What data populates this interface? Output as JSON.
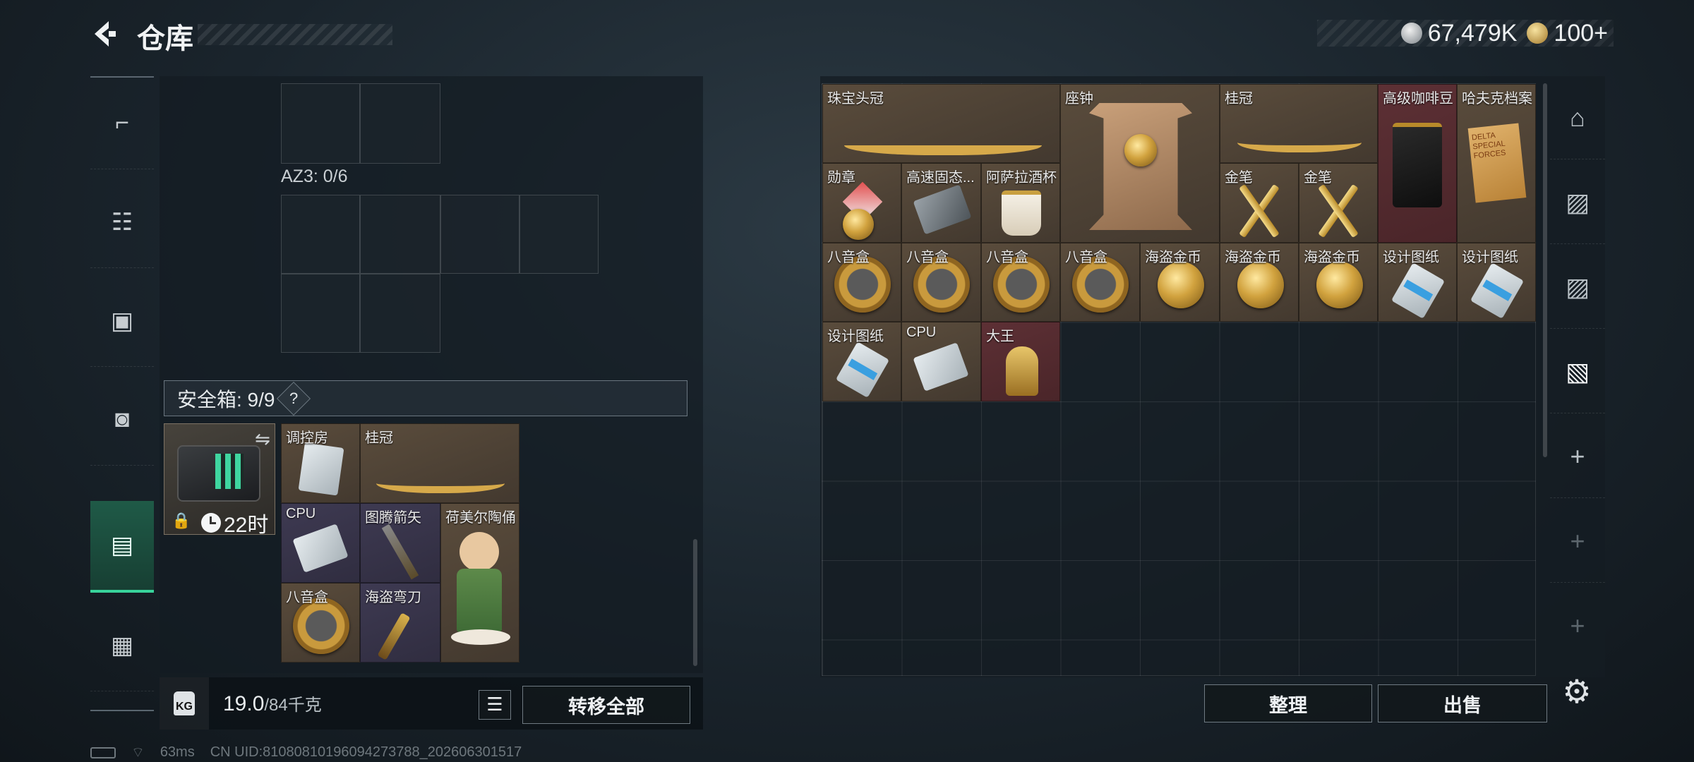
{
  "header": {
    "title": "仓库"
  },
  "currency": [
    {
      "icon": "silver-coin-icon",
      "value": "67,479K"
    },
    {
      "icon": "gold-coin-icon",
      "value": "100+"
    }
  ],
  "side_nav": [
    {
      "icon": "gun-icon",
      "glyph": "⌐"
    },
    {
      "icon": "vest-icon",
      "glyph": "☷"
    },
    {
      "icon": "chest-rig-icon",
      "glyph": "▣"
    },
    {
      "icon": "backpack-icon",
      "glyph": "◙"
    },
    {
      "icon": "safe-box-icon",
      "glyph": "▤",
      "active": true
    },
    {
      "icon": "toolbox-icon",
      "glyph": "▦"
    }
  ],
  "left_storage": {
    "container_label": "AZ3: 0/6",
    "safebox_label": "安全箱: 9/9",
    "help": "?",
    "case_timer": "22时",
    "items": [
      {
        "name": "调控房"
      },
      {
        "name": "桂冠"
      },
      {
        "name": "CPU"
      },
      {
        "name": "图腾箭矢"
      },
      {
        "name": "荷美尔陶俑"
      },
      {
        "name": "八音盒"
      },
      {
        "name": "海盗弯刀"
      }
    ]
  },
  "weight": {
    "current": "19.0",
    "max": "/84千克",
    "icon_text": "KG"
  },
  "left_buttons": {
    "transfer_all": "转移全部"
  },
  "right_storage": {
    "items": [
      {
        "name": "珠宝头冠"
      },
      {
        "name": "座钟"
      },
      {
        "name": "桂冠"
      },
      {
        "name": "高级咖啡豆"
      },
      {
        "name": "哈夫克档案"
      },
      {
        "name": "勋章"
      },
      {
        "name": "高速固态..."
      },
      {
        "name": "阿萨拉酒杯"
      },
      {
        "name": "金笔"
      },
      {
        "name": "金笔"
      },
      {
        "name": "八音盒"
      },
      {
        "name": "八音盒"
      },
      {
        "name": "八音盒"
      },
      {
        "name": "八音盒"
      },
      {
        "name": "海盗金币"
      },
      {
        "name": "海盗金币"
      },
      {
        "name": "海盗金币"
      },
      {
        "name": "设计图纸"
      },
      {
        "name": "设计图纸"
      },
      {
        "name": "设计图纸"
      },
      {
        "name": "CPU"
      },
      {
        "name": "大王"
      }
    ],
    "file_text": "DELTA SPECIAL FORCES"
  },
  "right_tabs": [
    {
      "icon": "storage-tab-icon",
      "glyph": "⌂"
    },
    {
      "icon": "storage-tab-4-icon",
      "glyph": "▨"
    },
    {
      "icon": "storage-tab-4b-icon",
      "glyph": "▨"
    },
    {
      "icon": "storage-tab-5-icon",
      "glyph": "▧"
    },
    {
      "icon": "add-tab-icon",
      "glyph": "+"
    },
    {
      "icon": "add-tab-icon",
      "glyph": "+"
    },
    {
      "icon": "add-tab-icon",
      "glyph": "+"
    }
  ],
  "right_buttons": {
    "sort": "整理",
    "sell": "出售"
  },
  "status": {
    "ping": "63ms",
    "uid": "CN UID:81080810196094273788_202606301517"
  },
  "colors": {
    "accent": "#38d39b",
    "rarity_tan": "#5a4c3c",
    "rarity_red": "#5d3035",
    "rarity_purple": "#3e3a52"
  }
}
